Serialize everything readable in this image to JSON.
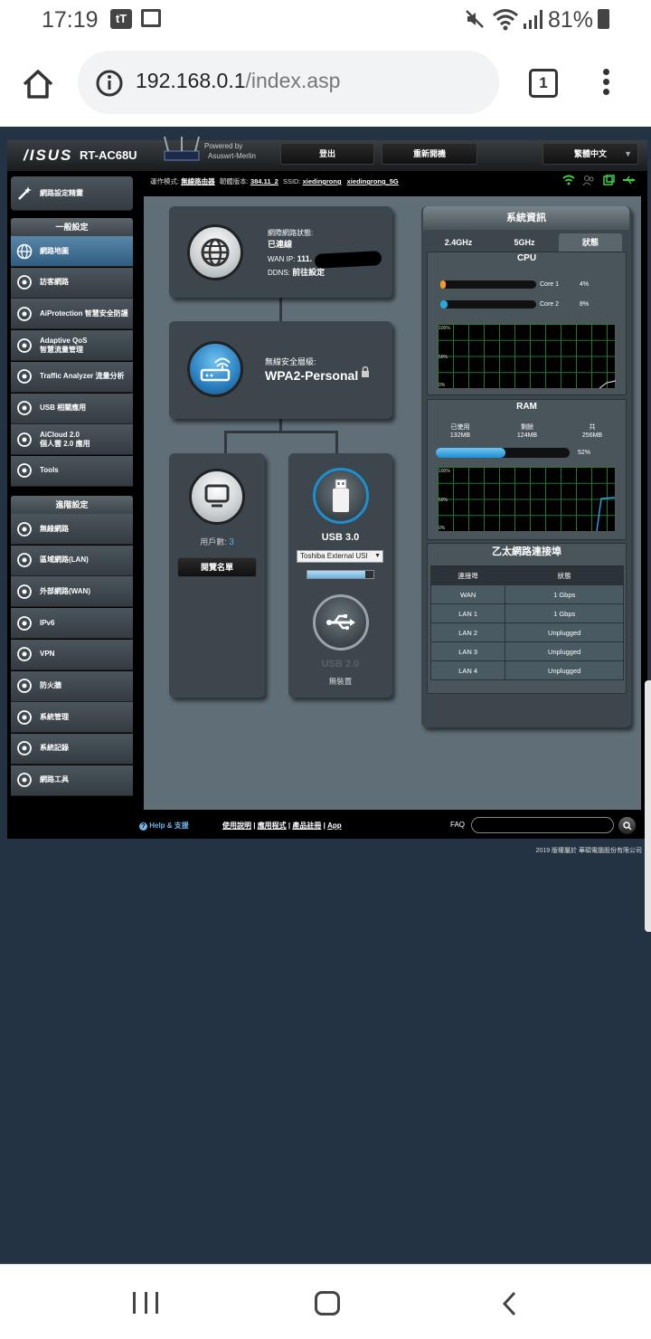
{
  "status_bar": {
    "time": "17:19",
    "battery": "81%"
  },
  "browser": {
    "url_host": "192.168.0.1",
    "url_path": "/index.asp",
    "tab_count": "1"
  },
  "router": {
    "brand": "/ISUS",
    "model": "RT-AC68U",
    "powered_by": "Powered by",
    "firmware_brand": "Asuswrt-Merlin",
    "logout": "登出",
    "reboot": "重新開機",
    "language": "繁體中文",
    "info_line": {
      "mode_label": "運作模式:",
      "mode_value": "無線路由器",
      "fw_label": "韌體版本:",
      "fw_value": "384.11_2",
      "ssid_label": "SSID:",
      "ssid_1": "xiedingrong",
      "ssid_2": "xiedingrong_5G"
    },
    "sidebar": {
      "wizard": "網路設定精靈",
      "general_header": "一般設定",
      "general_items": [
        {
          "label": "網路地圖",
          "icon": "globe-icon"
        },
        {
          "label": "訪客網路",
          "icon": "guest-network-icon"
        },
        {
          "label": "AiProtection 智慧安全防護",
          "icon": "shield-icon"
        },
        {
          "label": "Adaptive QoS\n智慧流量管理",
          "icon": "speedometer-icon"
        },
        {
          "label": "Traffic Analyzer 流量分析",
          "icon": "chart-icon"
        },
        {
          "label": "USB 相關應用",
          "icon": "usb-icon"
        },
        {
          "label": "AiCloud 2.0\n個人雲 2.0 應用",
          "icon": "cloud-icon"
        },
        {
          "label": "Tools",
          "icon": "wrench-icon"
        }
      ],
      "advanced_header": "進階設定",
      "advanced_items": [
        {
          "label": "無線網路",
          "icon": "wireless-icon"
        },
        {
          "label": "區域網路(LAN)",
          "icon": "lan-icon"
        },
        {
          "label": "外部網路(WAN)",
          "icon": "wan-globe-icon"
        },
        {
          "label": "IPv6",
          "icon": "ipv6-icon"
        },
        {
          "label": "VPN",
          "icon": "vpn-icon"
        },
        {
          "label": "防火牆",
          "icon": "firewall-icon"
        },
        {
          "label": "系統管理",
          "icon": "admin-icon"
        },
        {
          "label": "系統記錄",
          "icon": "log-icon"
        },
        {
          "label": "網路工具",
          "icon": "gear-icon"
        }
      ]
    },
    "internet": {
      "status_label": "網際網路狀態:",
      "status_value": "已連線",
      "wan_ip_label": "WAN IP:",
      "wan_ip_value": "111.",
      "ddns_label": "DDNS:",
      "ddns_value": "前往設定"
    },
    "wireless": {
      "security_label": "無線安全層級:",
      "security_value": "WPA2-Personal"
    },
    "clients": {
      "label": "用戶數:",
      "count": "3",
      "view_button": "閱覽名單"
    },
    "usb3": {
      "title": "USB 3.0",
      "device": "Toshiba External USI",
      "usage": 0.88
    },
    "usb2": {
      "title": "USB 2.0",
      "status": "無裝置"
    },
    "sysinfo": {
      "title": "系統資訊",
      "tabs": [
        "2.4GHz",
        "5GHz",
        "狀態"
      ],
      "cpu_title": "CPU",
      "cores": [
        {
          "name": "Core 1",
          "value": "4%",
          "fraction": 0.04,
          "color": "#f59a23"
        },
        {
          "name": "Core 2",
          "value": "8%",
          "fraction": 0.08,
          "color": "#29a8e0"
        }
      ],
      "graph_labels": [
        "100%",
        "50%",
        "0%"
      ],
      "ram_title": "RAM",
      "ram_used_label": "已使用",
      "ram_used": "132MB",
      "ram_free_label": "剩餘",
      "ram_free": "124MB",
      "ram_total_label": "共",
      "ram_total": "256MB",
      "ram_pct": "52%",
      "ram_fraction": 0.52,
      "eth_title": "乙太網路連接埠",
      "eth_headers": [
        "連接埠",
        "狀態"
      ],
      "eth_rows": [
        [
          "WAN",
          "1 Gbps"
        ],
        [
          "LAN 1",
          "1 Gbps"
        ],
        [
          "LAN 2",
          "Unplugged"
        ],
        [
          "LAN 3",
          "Unplugged"
        ],
        [
          "LAN 4",
          "Unplugged"
        ]
      ]
    },
    "footer": {
      "help": "Help & 支援",
      "links": [
        "使用說明",
        "應用程式",
        "產品註冊",
        "App"
      ],
      "faq": "FAQ",
      "copyright": "2019 版權屬於 華碩電腦股份有限公司"
    }
  },
  "colors": {
    "accent": "#29a8e0",
    "cpu1": "#f59a23",
    "panel": "#3c464c",
    "page_bg": "#243343"
  }
}
